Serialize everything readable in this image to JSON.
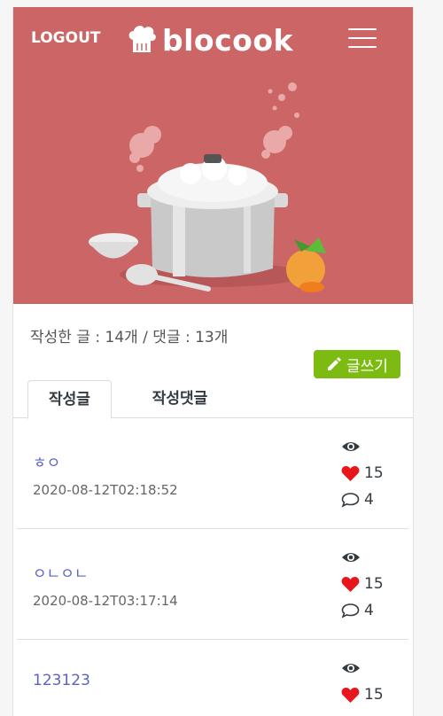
{
  "header": {
    "logout_label": "LOGOUT",
    "brand_name": "blocook",
    "menu_icon": "hamburger-menu-icon"
  },
  "colors": {
    "hero_bg": "#cc6666",
    "write_button": "#7dbb12",
    "post_title": "#5a63c4",
    "heart": "#e8161b"
  },
  "summary": {
    "stats_text": "작성한 글 : 14개 / 댓글 : 13개",
    "write_label": "글쓰기"
  },
  "tabs": [
    {
      "label": "작성글",
      "active": true
    },
    {
      "label": "작성댓글",
      "active": false
    }
  ],
  "posts": [
    {
      "title": "ㅎㅇ",
      "date": "2020-08-12T02:18:52",
      "likes": "15",
      "comments": "4"
    },
    {
      "title": "ㅇㄴㅇㄴ",
      "date": "2020-08-12T03:17:14",
      "likes": "15",
      "comments": "4"
    },
    {
      "title": "123123",
      "date": "",
      "likes": "15",
      "comments": ""
    }
  ]
}
